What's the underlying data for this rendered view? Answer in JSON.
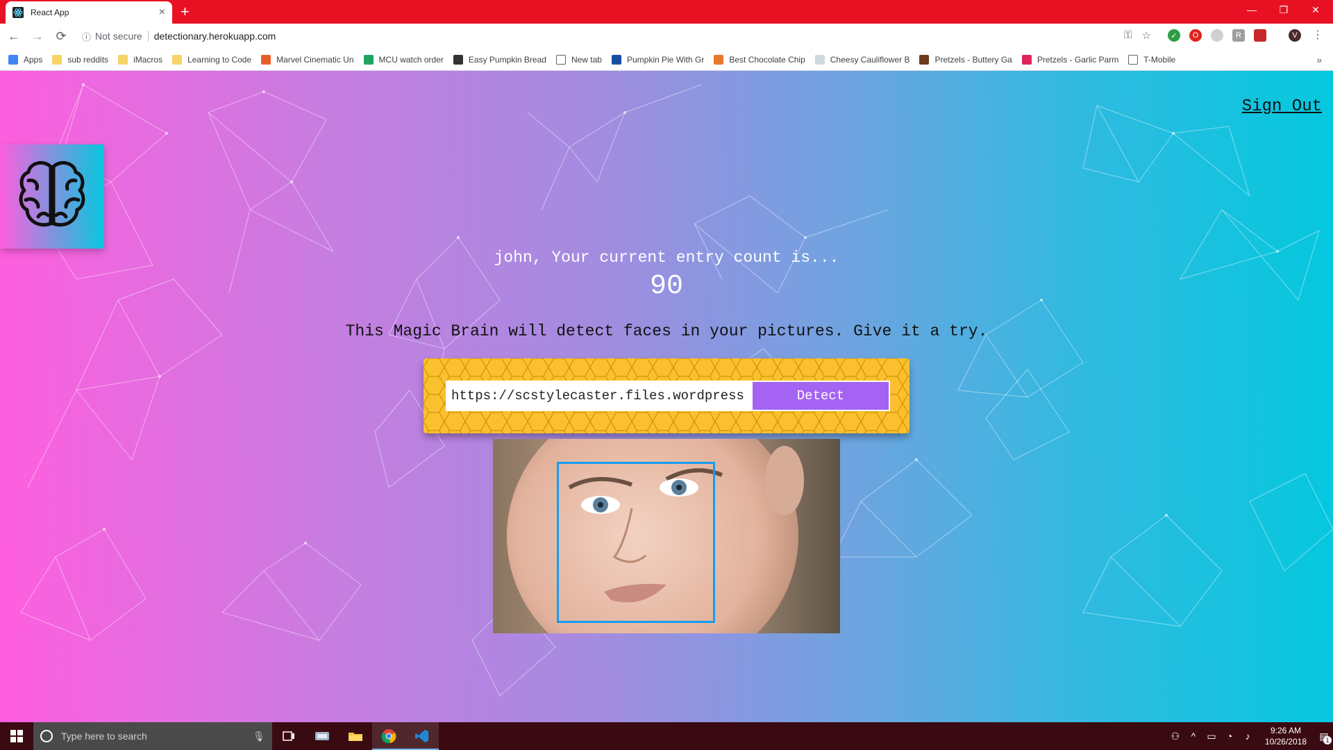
{
  "browser": {
    "tab_title": "React App",
    "close_glyph": "×",
    "newtab_glyph": "+",
    "minimize_glyph": "—",
    "restore_glyph": "❐",
    "close_window_glyph": "✕",
    "back_glyph": "←",
    "forward_glyph": "→",
    "reload_glyph": "⟳",
    "info_glyph": "ⓘ",
    "security_label": "Not secure",
    "url": "detectionary.herokuapp.com",
    "key_glyph": "⚿",
    "star_glyph": "☆",
    "profile_letter": "V",
    "menu_glyph": "⋮",
    "more_glyph": "»"
  },
  "bookmarks": [
    {
      "label": "Apps",
      "icon": "apps-icon",
      "color": "#4285f4"
    },
    {
      "label": "sub reddits",
      "icon": "folder-icon",
      "color": "#f6d365"
    },
    {
      "label": "iMacros",
      "icon": "folder-icon",
      "color": "#f6d365"
    },
    {
      "label": "Learning to Code",
      "icon": "folder-icon",
      "color": "#f6d365"
    },
    {
      "label": "Marvel Cinematic Un",
      "icon": "marvel-icon",
      "color": "#e85d2a"
    },
    {
      "label": "MCU watch order",
      "icon": "drive-icon",
      "color": "#1fa463"
    },
    {
      "label": "Easy Pumpkin Bread",
      "icon": "recipe-icon",
      "color": "#333333"
    },
    {
      "label": "New tab",
      "icon": "page-icon",
      "color": "#ffffff"
    },
    {
      "label": "Pumpkin Pie With Gr",
      "icon": "ps-icon",
      "color": "#1a4fa0"
    },
    {
      "label": "Best Chocolate Chip",
      "icon": "cookie-icon",
      "color": "#e8772e"
    },
    {
      "label": "Cheesy Cauliflower B",
      "icon": "image-icon",
      "color": "#cfd8dc"
    },
    {
      "label": "Pretzels - Buttery Ga",
      "icon": "pretzel-icon",
      "color": "#6d3b1e"
    },
    {
      "label": "Pretzels - Garlic Parm",
      "icon": "pinterest-icon",
      "color": "#e0245e"
    },
    {
      "label": "T-Mobile",
      "icon": "page-icon",
      "color": "#ffffff"
    }
  ],
  "app": {
    "signout_label": "Sign Out",
    "greeting": "john, Your current entry count is...",
    "entry_count": "90",
    "description": "This Magic Brain will detect faces in your pictures. Give it a try.",
    "input_value": "https://scstylecaster.files.wordpress",
    "detect_label": "Detect"
  },
  "taskbar": {
    "search_placeholder": "Type here to search",
    "time": "9:26 AM",
    "date": "10/26/2018",
    "notification_count": "1"
  },
  "colors": {
    "gradient_left": "#ff5edf",
    "gradient_right": "#04c8de",
    "form_yellow": "#fbc02d",
    "detect_purple": "#a463f2",
    "bounding_box": "#149df2"
  }
}
